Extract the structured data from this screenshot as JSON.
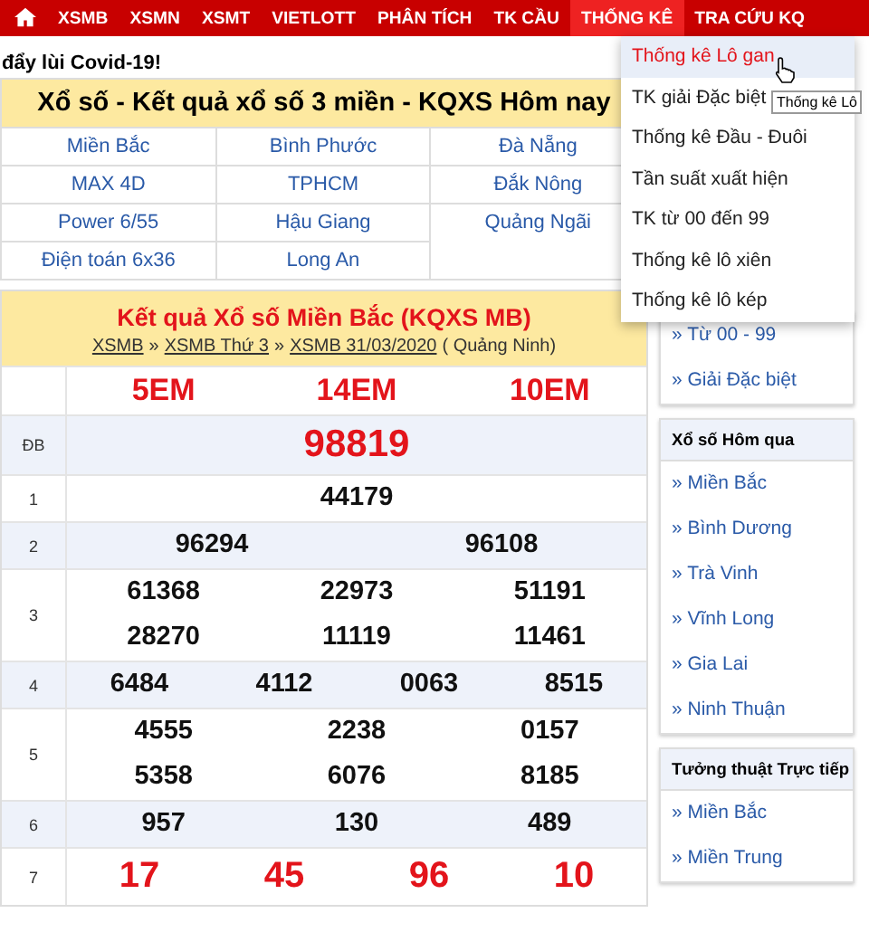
{
  "nav": {
    "items": [
      {
        "label": "XSMB",
        "selected": false
      },
      {
        "label": "XSMN",
        "selected": false
      },
      {
        "label": "XSMT",
        "selected": false
      },
      {
        "label": "VIETLOTT",
        "selected": false
      },
      {
        "label": "PHÂN TÍCH",
        "selected": false
      },
      {
        "label": "TK CẦU",
        "selected": false
      },
      {
        "label": "THỐNG KÊ",
        "selected": true
      },
      {
        "label": "TRA CỨU KQ",
        "selected": false
      }
    ]
  },
  "notice": "đẩy lùi Covid-19!",
  "regions": {
    "title": "Xổ số - Kết quả xổ số 3 miền - KQXS Hôm nay",
    "links": [
      "Miền Bắc",
      "Bình Phước",
      "Đà Nẵng",
      "MAX 4D",
      "TPHCM",
      "Đắk Nông",
      "Power 6/55",
      "Hậu Giang",
      "Quảng Ngãi",
      "Điện toán 6x36",
      "Long An"
    ]
  },
  "results": {
    "title": "Kết quả Xổ số Miền Bắc (KQXS MB)",
    "breadcrumb": [
      "XSMB",
      "XSMB Thứ 3",
      "XSMB 31/03/2020"
    ],
    "separator": "»",
    "place": "( Quảng Ninh)",
    "codes": [
      "5EM",
      "14EM",
      "10EM"
    ],
    "rows": [
      {
        "prize": "ĐB",
        "kind": "special",
        "numbers": [
          "98819"
        ]
      },
      {
        "prize": "1",
        "kind": "regular",
        "numbers": [
          "44179"
        ]
      },
      {
        "prize": "2",
        "kind": "regular",
        "numbers": [
          "96294",
          "96108"
        ]
      },
      {
        "prize": "3",
        "kind": "regular",
        "numbers": [
          "61368",
          "22973",
          "51191",
          "28270",
          "11119",
          "11461"
        ]
      },
      {
        "prize": "4",
        "kind": "regular",
        "numbers": [
          "6484",
          "4112",
          "0063",
          "8515"
        ]
      },
      {
        "prize": "5",
        "kind": "regular",
        "numbers": [
          "4555",
          "2238",
          "0157",
          "5358",
          "6076",
          "8185"
        ]
      },
      {
        "prize": "6",
        "kind": "regular",
        "numbers": [
          "957",
          "130",
          "489"
        ]
      },
      {
        "prize": "7",
        "kind": "last",
        "numbers": [
          "17",
          "45",
          "96",
          "10"
        ]
      }
    ]
  },
  "sidebar": [
    {
      "items": [
        "» Từ 00 - 99",
        "» Giải Đặc biệt"
      ]
    },
    {
      "title": "Xổ số Hôm qua",
      "items": [
        "» Miền Bắc",
        "» Bình Dương",
        "» Trà Vinh",
        "» Vĩnh Long",
        "» Gia Lai",
        "» Ninh Thuận"
      ]
    },
    {
      "title": "Tưởng thuật Trực tiếp",
      "items": [
        "» Miền Bắc",
        "» Miền Trung"
      ]
    }
  ],
  "dropdown": {
    "items": [
      {
        "label": "Thống kê Lô gan",
        "selected": true
      },
      {
        "label": "TK giải Đặc biệt",
        "selected": false
      },
      {
        "label": "Thống kê Đầu - Đuôi",
        "selected": false
      },
      {
        "label": "Tần suất xuất hiện",
        "selected": false
      },
      {
        "label": "TK từ 00 đến 99",
        "selected": false
      },
      {
        "label": "Thống kê lô xiên",
        "selected": false
      },
      {
        "label": "Thống kê lô kép",
        "selected": false
      }
    ]
  },
  "tooltip": "Thống kê Lô"
}
